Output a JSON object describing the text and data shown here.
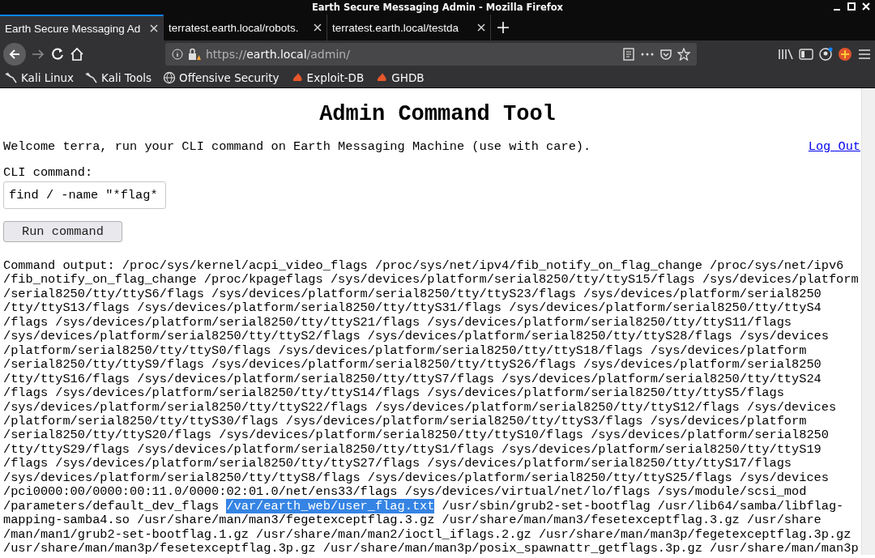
{
  "window": {
    "title": "Earth Secure Messaging Admin - Mozilla Firefox"
  },
  "tabs": [
    {
      "label": "Earth Secure Messaging Ad",
      "selected": true
    },
    {
      "label": "terratest.earth.local/robots.",
      "selected": false
    },
    {
      "label": "terratest.earth.local/testda",
      "selected": false
    }
  ],
  "address_bar": {
    "url_prefix": "https://",
    "url_host": "earth.local",
    "url_path": "/admin/"
  },
  "bookmarks": [
    {
      "label": "Kali Linux",
      "kind": "kali"
    },
    {
      "label": "Kali Tools",
      "kind": "kali"
    },
    {
      "label": "Offensive Security",
      "kind": "globe"
    },
    {
      "label": "Exploit-DB",
      "kind": "flame"
    },
    {
      "label": "GHDB",
      "kind": "flame"
    }
  ],
  "page": {
    "heading": "Admin Command Tool",
    "welcome": "Welcome terra, run your CLI command on Earth Messaging Machine (use with care).",
    "logout_link": "Log Out",
    "cli_label": "CLI command:",
    "cli_value": "find / -name \"*flag*",
    "run_button": "Run command",
    "output_lines": [
      [
        {
          "text": "Command output: /proc/sys/kernel/acpi_video_flags /proc/sys/net/ipv4/fib_notify_on_flag_change /proc/sys/net/ipv6",
          "selected": false
        }
      ],
      [
        {
          "text": "/fib_notify_on_flag_change /proc/kpageflags /sys/devices/platform/serial8250/tty/ttyS15/flags /sys/devices/platform",
          "selected": false
        }
      ],
      [
        {
          "text": "/serial8250/tty/ttyS6/flags /sys/devices/platform/serial8250/tty/ttyS23/flags /sys/devices/platform/serial8250",
          "selected": false
        }
      ],
      [
        {
          "text": "/tty/ttyS13/flags /sys/devices/platform/serial8250/tty/ttyS31/flags /sys/devices/platform/serial8250/tty/ttyS4",
          "selected": false
        }
      ],
      [
        {
          "text": "/flags /sys/devices/platform/serial8250/tty/ttyS21/flags /sys/devices/platform/serial8250/tty/ttyS11/flags",
          "selected": false
        }
      ],
      [
        {
          "text": "/sys/devices/platform/serial8250/tty/ttyS2/flags /sys/devices/platform/serial8250/tty/ttyS28/flags /sys/devices",
          "selected": false
        }
      ],
      [
        {
          "text": "/platform/serial8250/tty/ttyS0/flags /sys/devices/platform/serial8250/tty/ttyS18/flags /sys/devices/platform",
          "selected": false
        }
      ],
      [
        {
          "text": "/serial8250/tty/ttyS9/flags /sys/devices/platform/serial8250/tty/ttyS26/flags /sys/devices/platform/serial8250",
          "selected": false
        }
      ],
      [
        {
          "text": "/tty/ttyS16/flags /sys/devices/platform/serial8250/tty/ttyS7/flags /sys/devices/platform/serial8250/tty/ttyS24",
          "selected": false
        }
      ],
      [
        {
          "text": "/flags /sys/devices/platform/serial8250/tty/ttyS14/flags /sys/devices/platform/serial8250/tty/ttyS5/flags",
          "selected": false
        }
      ],
      [
        {
          "text": "/sys/devices/platform/serial8250/tty/ttyS22/flags /sys/devices/platform/serial8250/tty/ttyS12/flags /sys/devices",
          "selected": false
        }
      ],
      [
        {
          "text": "/platform/serial8250/tty/ttyS30/flags /sys/devices/platform/serial8250/tty/ttyS3/flags /sys/devices/platform",
          "selected": false
        }
      ],
      [
        {
          "text": "/serial8250/tty/ttyS20/flags /sys/devices/platform/serial8250/tty/ttyS10/flags /sys/devices/platform/serial8250",
          "selected": false
        }
      ],
      [
        {
          "text": "/tty/ttyS29/flags /sys/devices/platform/serial8250/tty/ttyS1/flags /sys/devices/platform/serial8250/tty/ttyS19",
          "selected": false
        }
      ],
      [
        {
          "text": "/flags /sys/devices/platform/serial8250/tty/ttyS27/flags /sys/devices/platform/serial8250/tty/ttyS17/flags",
          "selected": false
        }
      ],
      [
        {
          "text": "/sys/devices/platform/serial8250/tty/ttyS8/flags /sys/devices/platform/serial8250/tty/ttyS25/flags /sys/devices",
          "selected": false
        }
      ],
      [
        {
          "text": "/pci0000:00/0000:00:11.0/0000:02:01.0/net/ens33/flags /sys/devices/virtual/net/lo/flags /sys/module/scsi_mod",
          "selected": false
        }
      ],
      [
        {
          "text": "/parameters/default_dev_flags ",
          "selected": false
        },
        {
          "text": "/var/earth_web/user_flag.txt",
          "selected": true
        },
        {
          "text": " /usr/sbin/grub2-set-bootflag /usr/lib64/samba/libflag-",
          "selected": false
        }
      ],
      [
        {
          "text": "mapping-samba4.so /usr/share/man/man3/fegetexceptflag.3.gz /usr/share/man/man3/fesetexceptflag.3.gz /usr/share",
          "selected": false
        }
      ],
      [
        {
          "text": "/man/man1/grub2-set-bootflag.1.gz /usr/share/man/man2/ioctl_iflags.2.gz /usr/share/man/man3p/fegetexceptflag.3p.gz",
          "selected": false
        }
      ],
      [
        {
          "text": "/usr/share/man/man3p/fesetexceptflag.3p.gz /usr/share/man/man3p/posix_spawnattr_getflags.3p.gz /usr/share/man/man3p",
          "selected": false
        }
      ]
    ]
  }
}
